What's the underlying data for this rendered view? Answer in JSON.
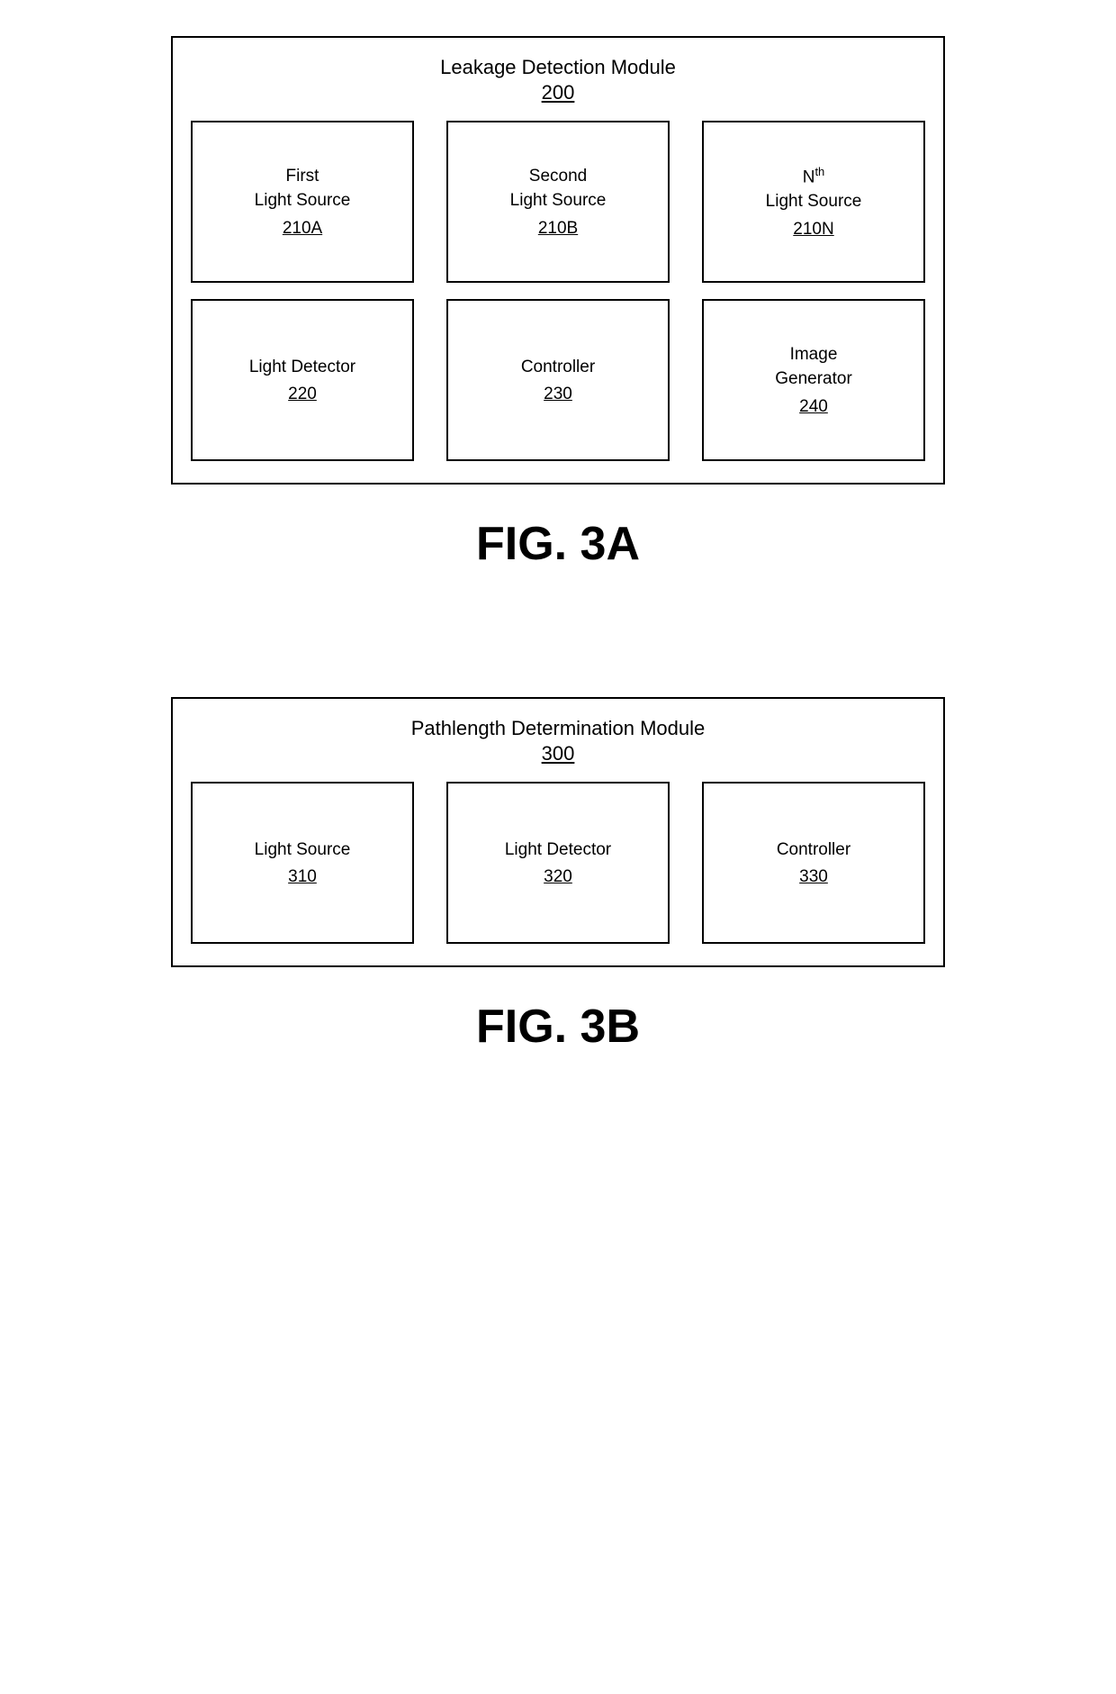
{
  "fig3a": {
    "module_title": "Leakage Detection Module",
    "module_number": "200",
    "row1": [
      {
        "label": "First\nLight Source",
        "number": "210A"
      },
      {
        "label": "Second\nLight Source",
        "number": "210B"
      },
      {
        "label_parts": [
          "N",
          "th",
          " Light Source"
        ],
        "number": "210N",
        "has_superscript": true
      }
    ],
    "row2": [
      {
        "label": "Light Detector",
        "number": "220"
      },
      {
        "label": "Controller",
        "number": "230"
      },
      {
        "label": "Image\nGenerator",
        "number": "240"
      }
    ],
    "fig_label": "FIG. 3A"
  },
  "fig3b": {
    "module_title": "Pathlength Determination Module",
    "module_number": "300",
    "row1": [
      {
        "label": "Light Source",
        "number": "310"
      },
      {
        "label": "Light Detector",
        "number": "320"
      },
      {
        "label": "Controller",
        "number": "330"
      }
    ],
    "fig_label": "FIG. 3B"
  }
}
